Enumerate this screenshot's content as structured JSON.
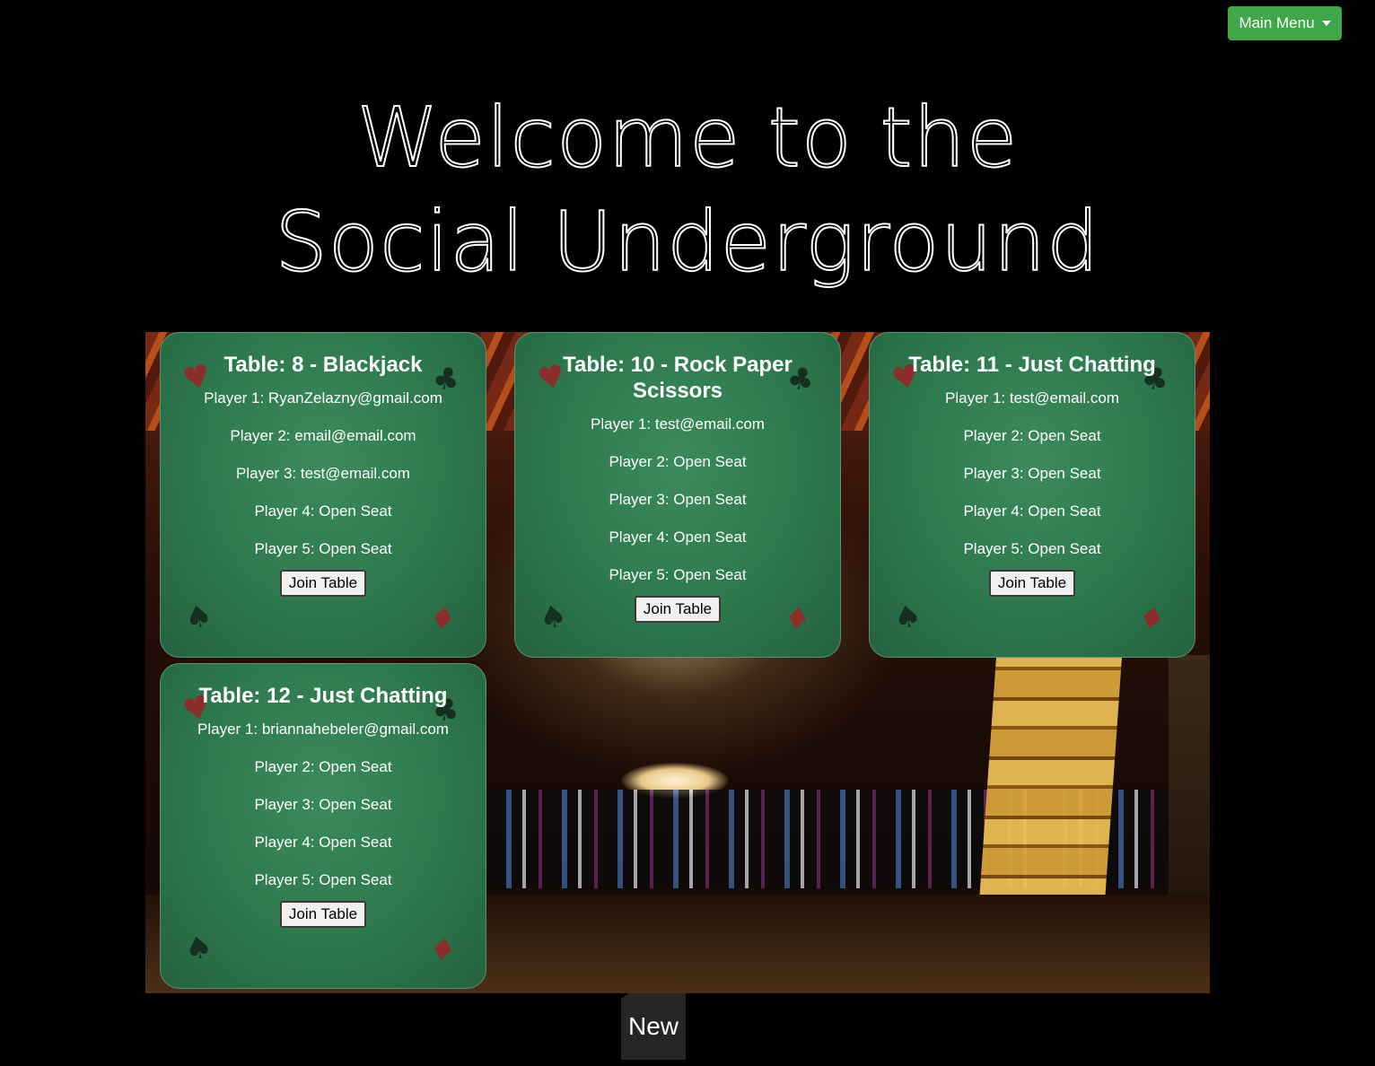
{
  "header": {
    "menu_label": "Main Menu"
  },
  "hero": {
    "line1": "Welcome to the",
    "line2": "Social Underground"
  },
  "tables": [
    {
      "title": "Table: 8 - Blackjack",
      "players": [
        "Player 1: RyanZelazny@gmail.com",
        "Player 2: email@email.com",
        "Player 3: test@email.com",
        "Player 4: Open Seat",
        "Player 5: Open Seat"
      ],
      "join_label": "Join Table"
    },
    {
      "title": "Table: 10 - Rock Paper Scissors",
      "players": [
        "Player 1: test@email.com",
        "Player 2: Open Seat",
        "Player 3: Open Seat",
        "Player 4: Open Seat",
        "Player 5: Open Seat"
      ],
      "join_label": "Join Table"
    },
    {
      "title": "Table: 11 - Just Chatting",
      "players": [
        "Player 1: test@email.com",
        "Player 2: Open Seat",
        "Player 3: Open Seat",
        "Player 4: Open Seat",
        "Player 5: Open Seat"
      ],
      "join_label": "Join Table"
    },
    {
      "title": "Table: 12 - Just Chatting",
      "players": [
        "Player 1: briannahebeler@gmail.com",
        "Player 2: Open Seat",
        "Player 3: Open Seat",
        "Player 4: Open Seat",
        "Player 5: Open Seat"
      ],
      "join_label": "Join Table"
    }
  ],
  "footer": {
    "new_label": "New"
  },
  "icons": {
    "card_suits": [
      "heart-icon",
      "club-icon",
      "spade-icon",
      "diamond-icon"
    ]
  },
  "colors": {
    "menu_button": "#3fa64a",
    "felt": "#2f7a4e",
    "background": "#000000"
  }
}
